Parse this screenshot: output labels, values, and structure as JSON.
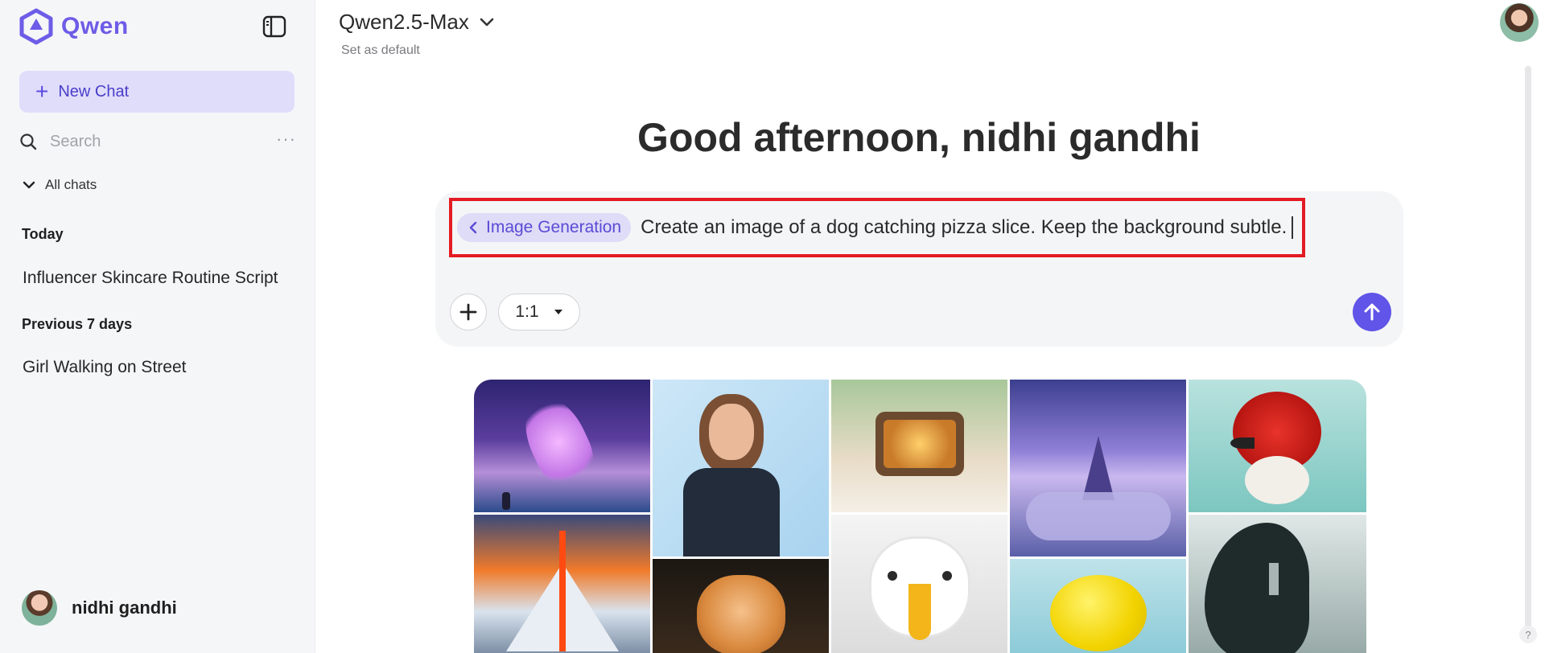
{
  "app": {
    "name": "Qwen"
  },
  "sidebar": {
    "new_chat_label": "New Chat",
    "search": {
      "placeholder": "Search",
      "value": ""
    },
    "all_chats_label": "All chats",
    "sections": [
      {
        "title": "Today",
        "items": [
          "Influencer Skincare Routine Script"
        ]
      },
      {
        "title": "Previous 7 days",
        "items": [
          "Girl Walking on Street"
        ]
      }
    ],
    "user": {
      "name": "nidhi gandhi"
    }
  },
  "header": {
    "model_name": "Qwen2.5-Max",
    "set_default_label": "Set as default"
  },
  "main": {
    "greeting": "Good afternoon, nidhi gandhi",
    "prompt": {
      "mode_chip": "Image Generation",
      "text": "Create an image of a dog catching pizza slice. Keep the background subtle.",
      "aspect_ratio": "1:1"
    },
    "gallery": [
      "whale-in-sky",
      "woman-presenting",
      "tiny-room-in-microwave",
      "castle-in-clouds",
      "red-spiky-bird",
      "volcano-eruption",
      "cat-portrait",
      "eagle-portrait",
      "lemon-splash",
      "silhouette-forest"
    ]
  },
  "colors": {
    "accent": "#6154e8",
    "accent_light": "#e0ddfb",
    "highlight_border": "#e31b23",
    "sidebar_bg": "#f5f6f8"
  },
  "help_label": "?"
}
